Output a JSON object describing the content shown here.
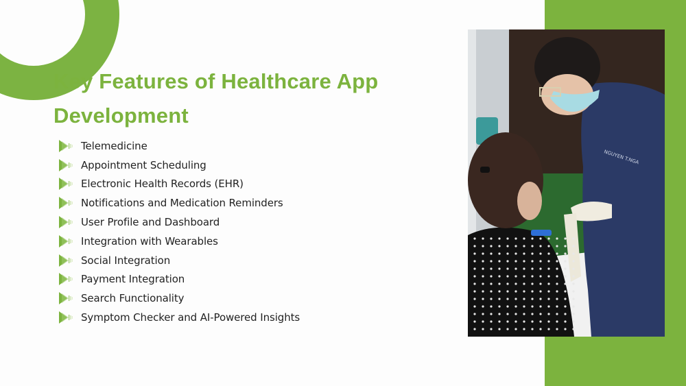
{
  "slide": {
    "title": "Key Features of Healthcare App Development",
    "bullet_icon": "play-arrow-icon",
    "features": [
      {
        "label": "Telemedicine"
      },
      {
        "label": "Appointment Scheduling"
      },
      {
        "label": "Electronic Health Records (EHR)"
      },
      {
        "label": "Notifications and Medication Reminders"
      },
      {
        "label": "User Profile and Dashboard"
      },
      {
        "label": "Integration with Wearables"
      },
      {
        "label": "Social Integration"
      },
      {
        "label": "Payment Integration"
      },
      {
        "label": "Search Functionality"
      },
      {
        "label": "Symptom Checker and AI-Powered Insights"
      }
    ],
    "photo": {
      "description": "Healthcare worker in navy scrubs, face mask and gloves attending to a seated patient in polka-dot top",
      "scrub_text": "NGUYEN T.NGA"
    },
    "colors": {
      "accent": "#7cb33e",
      "text": "#222222",
      "background": "#fdfdfd",
      "scrubs": "#2b3a66"
    }
  }
}
